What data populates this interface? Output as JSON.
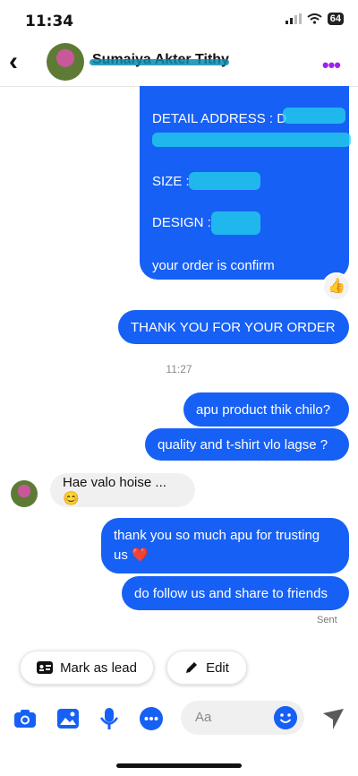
{
  "status_bar": {
    "time": "11:34",
    "battery": "64"
  },
  "header": {
    "contact_name": "Sumaiya Akter Tithy",
    "back_icon": "chevron-left-icon",
    "more_icon": "more-dots-icon"
  },
  "messages": {
    "order_bubble": {
      "detail_address": "DETAIL ADDRESS : D",
      "size": "SIZE :",
      "design": "DESIGN :",
      "confirm": "your order is confirm"
    },
    "reaction": "👍",
    "thank_you_order": "THANK YOU FOR YOUR ORDER",
    "timestamp": "11:27",
    "out_1": "apu product thik chilo?",
    "out_2": "quality and t-shirt vlo lagse ?",
    "in_1": "Hae valo hoise ...😊",
    "out_3": "thank you so much apu for trusting us ❤️",
    "out_4": "do follow us and share to friends",
    "sent": "Sent"
  },
  "actions": {
    "mark_as_lead": "Mark as lead",
    "edit": "Edit"
  },
  "composer": {
    "placeholder": "Aa"
  },
  "colors": {
    "accent": "#1760f5",
    "menu": "#a020f0"
  }
}
